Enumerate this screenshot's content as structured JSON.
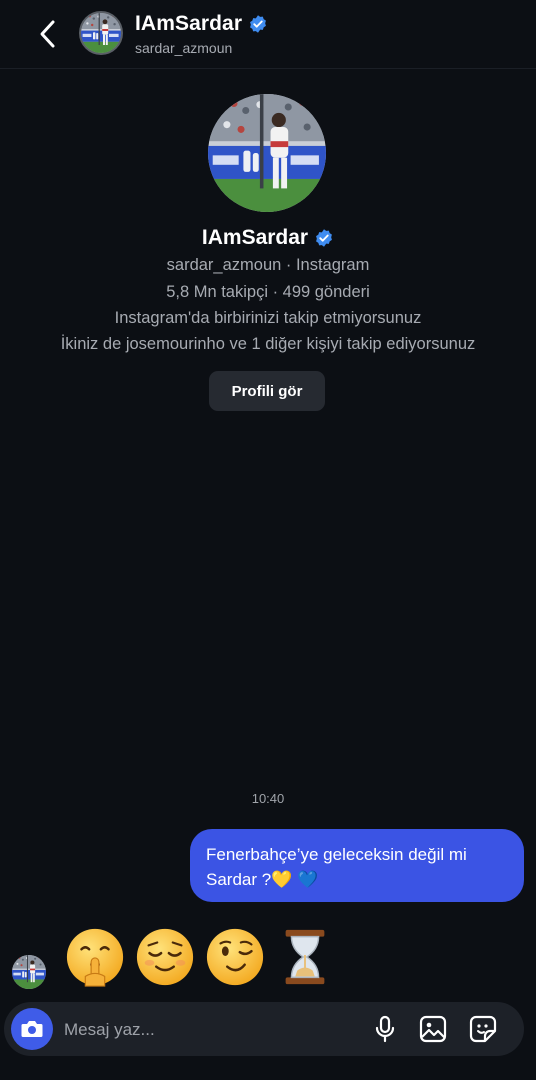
{
  "header": {
    "display_name": "IAmSardar",
    "handle": "sardar_azmoun"
  },
  "profile": {
    "display_name": "IAmSardar",
    "handle_line": "sardar_azmoun · Instagram",
    "stats_line": "5,8 Mn takipçi · 499 gönderi",
    "follow_line": "Instagram'da birbirinizi takip etmiyorsunuz",
    "mutual_line": "İkiniz de josemourinho ve 1 diğer kişiyi takip ediyorsunuz",
    "view_profile_label": "Profili gör"
  },
  "messages": {
    "timestamp": "10:40",
    "sent_text_line1": "Fenerbahçe’ye geleceksin değil mi",
    "sent_text_line2": "Sardar ?",
    "sent_emojis": "💛 💙",
    "reply_emojis": [
      "shushing-face",
      "relieved-face",
      "winking-face",
      "hourglass"
    ]
  },
  "composer": {
    "placeholder": "Mesaj yaz..."
  },
  "colors": {
    "background": "#0c0f14",
    "bubble": "#3b54e4",
    "verified": "#3f8cf0",
    "camera": "#3f5ce8",
    "button": "#262a31"
  }
}
